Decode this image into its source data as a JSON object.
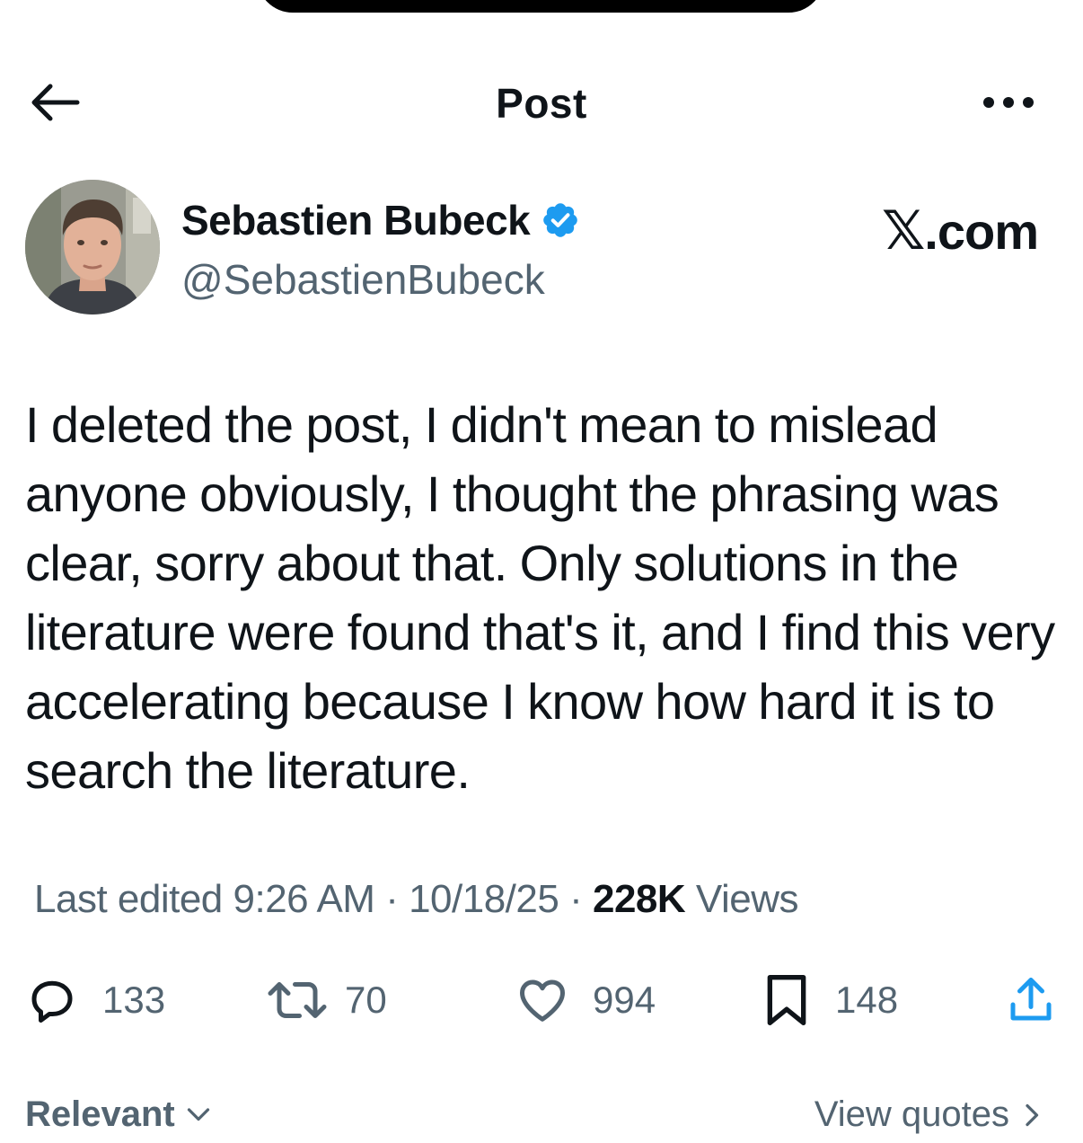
{
  "header": {
    "title": "Post",
    "back_icon": "arrow-left-icon",
    "more_icon": "more-dots-icon"
  },
  "author": {
    "name": "Sebastien Bubeck",
    "handle": "@SebastienBubeck",
    "verified": true,
    "verified_color": "#1d9bf0"
  },
  "watermark": {
    "x_letter": "𝕏",
    "domain": ".com"
  },
  "post": {
    "text": "I deleted the post, I didn't mean to mislead anyone obviously, I thought the phrasing was clear, sorry about that. Only solutions in the literature were found that's it, and I find this very accelerating because I know how hard it is to search the literature."
  },
  "meta": {
    "prefix": "Last edited",
    "time": "9:26 AM",
    "date": "10/18/25",
    "separator": "·",
    "views_count": "228K",
    "views_label": "Views"
  },
  "actions": {
    "replies": "133",
    "reposts": "70",
    "likes": "994",
    "bookmarks": "148"
  },
  "footer": {
    "sort_label": "Relevant",
    "quotes_label": "View quotes"
  },
  "colors": {
    "text": "#0f1419",
    "secondary": "#536471",
    "accent": "#1d9bf0"
  }
}
